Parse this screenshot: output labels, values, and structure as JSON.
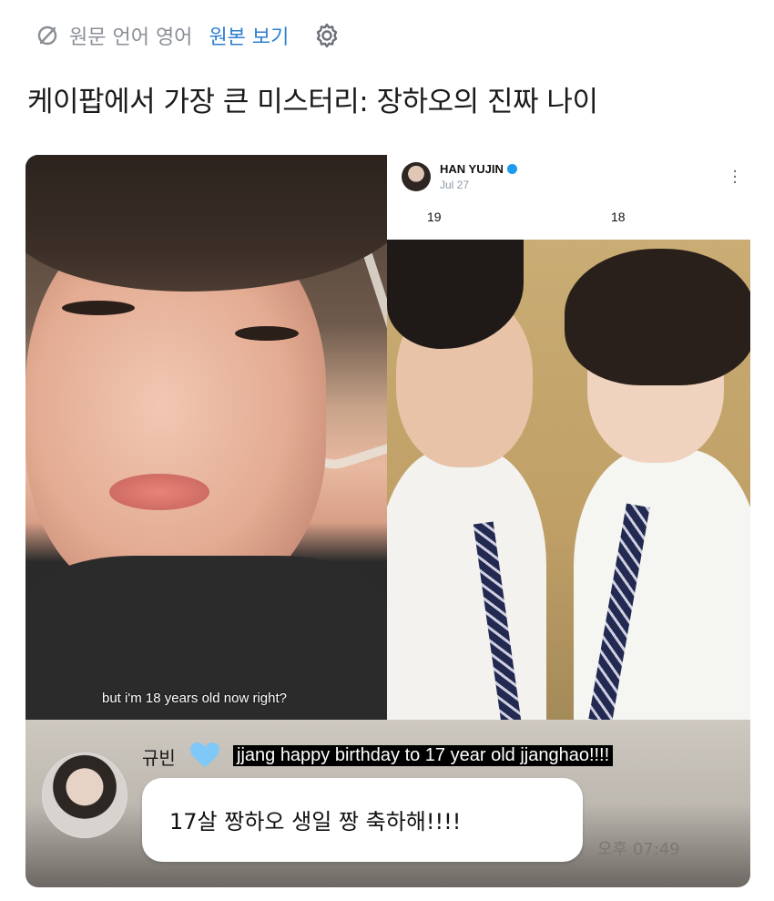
{
  "toolbar": {
    "lang_text": "원문 언어 영어",
    "view_original": "원본 보기"
  },
  "title": "케이팝에서 가장 큰 미스터리: 장하오의 진짜 나이",
  "left_panel": {
    "caption": "but i'm 18 years old now right?"
  },
  "tweet": {
    "name": "HAN YUJIN",
    "date": "Jul 27",
    "age_left": "19",
    "age_right": "18"
  },
  "chat": {
    "name": "규빈",
    "english_caption": "jjang happy birthday to 17 year old jjanghao!!!!",
    "message": "17살 짱하오 생일 짱 축하해!!!!",
    "time": "오후 07:49"
  },
  "colors": {
    "link_blue": "#2f7fd1",
    "muted_gray": "#8a8f96",
    "verified_blue": "#1d9bf0",
    "heart_blue": "#7fc8f8"
  },
  "icons": [
    "translate-off-icon",
    "gear-icon",
    "verified-badge-icon",
    "more-vert-icon",
    "heart-icon"
  ]
}
